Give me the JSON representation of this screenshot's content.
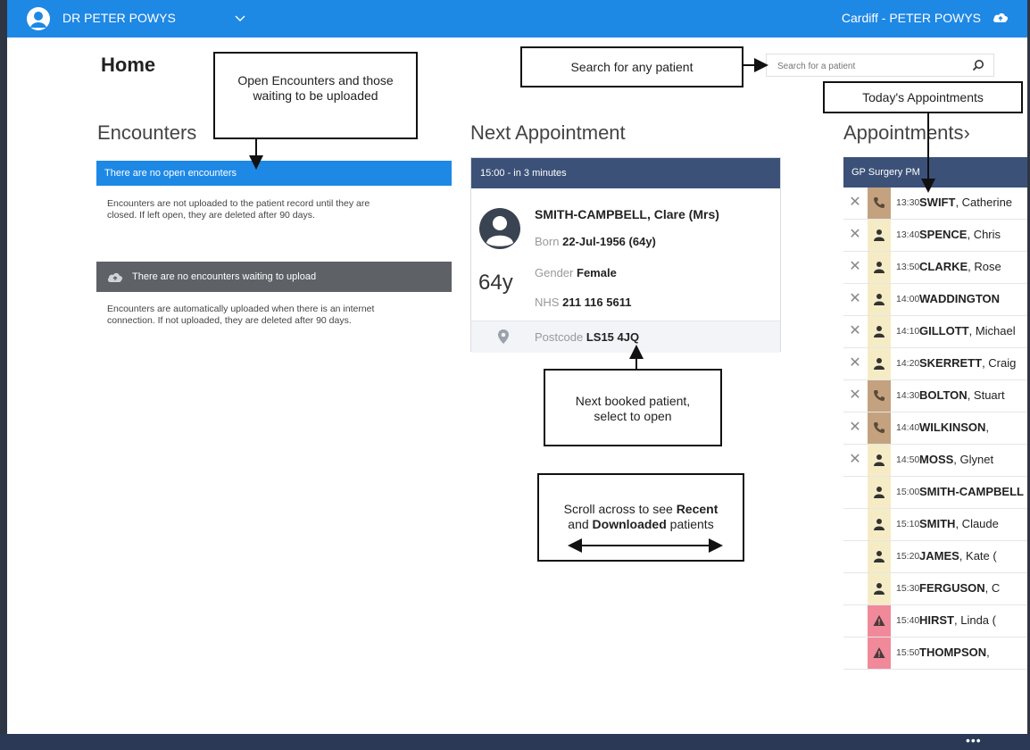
{
  "topbar": {
    "user_name": "DR PETER POWYS",
    "site_user": "Cardiff - PETER POWYS"
  },
  "home": {
    "title": "Home"
  },
  "encounters": {
    "title": "Encounters",
    "open_status": "There are no open encounters",
    "open_note": "Encounters are not uploaded to the patient record until they are closed. If left open, they are deleted after 90 days.",
    "upload_status": "There are no encounters waiting to upload",
    "upload_note": "Encounters are automatically uploaded when there is an internet connection. If not uploaded, they are deleted after 90 days."
  },
  "next_appointment": {
    "title": "Next Appointment",
    "time": "15:00 - in 3 minutes",
    "patient_name": "SMITH-CAMPBELL, Clare (Mrs)",
    "born_label": "Born",
    "born_value": "22-Jul-1956 (64y)",
    "gender_label": "Gender",
    "gender_value": "Female",
    "nhs_label": "NHS",
    "nhs_value": "211 116 5611",
    "age": "64y",
    "postcode_label": "Postcode",
    "postcode_value": "LS15 4JQ"
  },
  "search": {
    "placeholder": "Search for a patient"
  },
  "appointments": {
    "title": "Appointments",
    "session": "GP Surgery PM",
    "items": [
      {
        "time": "13:30",
        "surname": "SWIFT",
        "rest": ", Catherine",
        "icon": "phone-icon",
        "strip": "#c4a27f",
        "cancel": true
      },
      {
        "time": "13:40",
        "surname": "SPENCE",
        "rest": ", Chris",
        "icon": "person-icon",
        "strip": "#f5ecc6",
        "cancel": true
      },
      {
        "time": "13:50",
        "surname": "CLARKE",
        "rest": ", Rose",
        "icon": "person-icon",
        "strip": "#f5ecc6",
        "cancel": true
      },
      {
        "time": "14:00",
        "surname": "WADDINGTON",
        "rest": "",
        "icon": "person-icon",
        "strip": "#f5ecc6",
        "cancel": true
      },
      {
        "time": "14:10",
        "surname": "GILLOTT",
        "rest": ", Michael",
        "icon": "person-icon",
        "strip": "#f5ecc6",
        "cancel": true
      },
      {
        "time": "14:20",
        "surname": "SKERRETT",
        "rest": ", Craig",
        "icon": "person-icon",
        "strip": "#f5ecc6",
        "cancel": true
      },
      {
        "time": "14:30",
        "surname": "BOLTON",
        "rest": ", Stuart",
        "icon": "phone-icon",
        "strip": "#c4a27f",
        "cancel": true
      },
      {
        "time": "14:40",
        "surname": "WILKINSON",
        "rest": ",",
        "icon": "phone-icon",
        "strip": "#c4a27f",
        "cancel": true
      },
      {
        "time": "14:50",
        "surname": "MOSS",
        "rest": ", Glynet",
        "icon": "person-icon",
        "strip": "#f5ecc6",
        "cancel": true
      },
      {
        "time": "15:00",
        "surname": "SMITH-CAMPBELL",
        "rest": "",
        "icon": "person-icon",
        "strip": "#f5ecc6",
        "cancel": false
      },
      {
        "time": "15:10",
        "surname": "SMITH",
        "rest": ", Claude",
        "icon": "person-icon",
        "strip": "#f5ecc6",
        "cancel": false
      },
      {
        "time": "15:20",
        "surname": "JAMES",
        "rest": ", Kate (",
        "icon": "person-icon",
        "strip": "#f5ecc6",
        "cancel": false
      },
      {
        "time": "15:30",
        "surname": "FERGUSON",
        "rest": ", C",
        "icon": "person-icon",
        "strip": "#f5ecc6",
        "cancel": false
      },
      {
        "time": "15:40",
        "surname": "HIRST",
        "rest": ", Linda (",
        "icon": "warning-icon",
        "strip": "#f08a9a",
        "cancel": false
      },
      {
        "time": "15:50",
        "surname": "THOMPSON",
        "rest": ",",
        "icon": "warning-icon",
        "strip": "#f08a9a",
        "cancel": false
      }
    ]
  },
  "callouts": {
    "encounters": "Open Encounters and those waiting to be uploaded",
    "search": "Search for any patient",
    "todays": "Today's Appointments",
    "next_patient": "Next booked patient, select to open",
    "scroll_pre": "Scroll across to see ",
    "scroll_recent": "Recent",
    "scroll_and": " and ",
    "scroll_downloaded": "Downloaded",
    "scroll_post": " patients"
  },
  "colors": {
    "topbar": "#1e88e5",
    "card_header": "#3c5178",
    "footer": "#2b3957",
    "upload_bar": "#5e6166"
  }
}
